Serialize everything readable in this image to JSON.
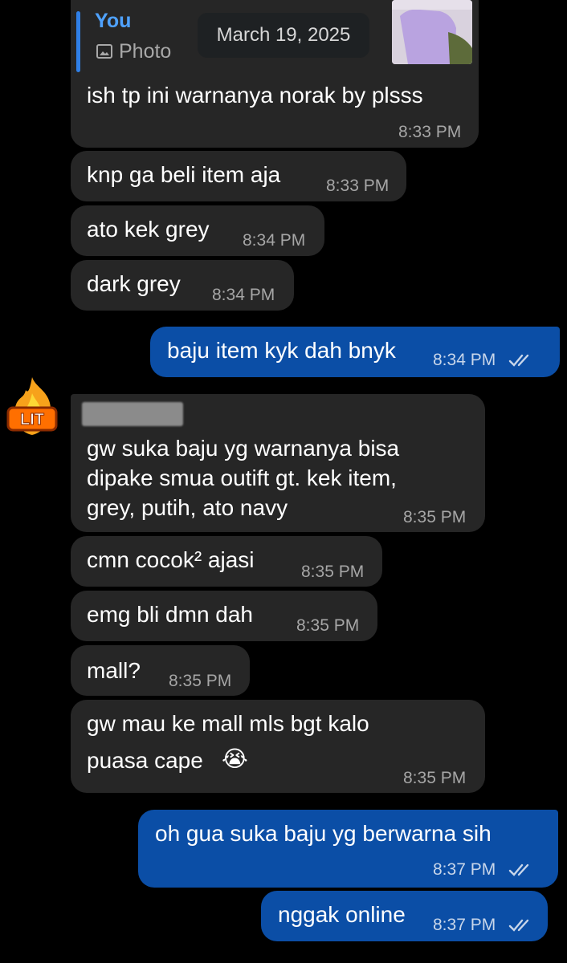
{
  "reply": {
    "sender": "You",
    "type": "Photo"
  },
  "date_chip": "March 19, 2025",
  "sticker_text": "LIT",
  "messages": [
    {
      "text": "ish tp ini warnanya norak by plsss",
      "time": "8:33 PM"
    },
    {
      "text": "knp ga beli item aja",
      "time": "8:33 PM"
    },
    {
      "text": "ato kek grey",
      "time": "8:34 PM"
    },
    {
      "text": "dark grey",
      "time": "8:34 PM"
    },
    {
      "text": "baju item kyk dah bnyk",
      "time": "8:34 PM"
    },
    {
      "lines": [
        "gw suka baju yg warnanya bisa",
        "dipake smua outift gt. kek item,",
        "grey, putih, ato navy"
      ],
      "time": "8:35 PM"
    },
    {
      "text": "cmn cocok² ajasi",
      "time": "8:35 PM"
    },
    {
      "text": "emg bli dmn dah",
      "time": "8:35 PM"
    },
    {
      "text": "mall?",
      "time": "8:35 PM"
    },
    {
      "lines": [
        "gw mau ke mall mls bgt kalo",
        "puasa cape"
      ],
      "emoji": "😭",
      "time": "8:35 PM"
    },
    {
      "text": "oh gua suka baju yg berwarna sih",
      "time": "8:37 PM"
    },
    {
      "text": "nggak online",
      "time": "8:37 PM"
    }
  ],
  "colors": {
    "incoming": "#262626",
    "outgoing": "#0b4ea6",
    "reply_accent": "#2f7fe6"
  },
  "icons": [
    "photo-icon",
    "double-check-icon",
    "fire-lit-sticker",
    "crying-face-emoji"
  ]
}
